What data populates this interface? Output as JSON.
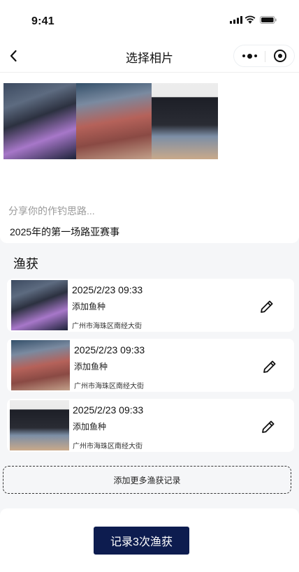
{
  "status": {
    "time": "9:41"
  },
  "nav": {
    "title": "选择相片"
  },
  "share": {
    "placeholder": "分享你的作钓思路...",
    "text": "2025年的第一场路亚赛事"
  },
  "catch_section": {
    "title": "渔获"
  },
  "catches": [
    {
      "datetime": "2025/2/23 09:33",
      "species": "添加鱼种",
      "location": "广州市海珠区南经大街"
    },
    {
      "datetime": "2025/2/23 09:33",
      "species": "添加鱼种",
      "location": "广州市海珠区南经大街"
    },
    {
      "datetime": "2025/2/23 09:33",
      "species": "添加鱼种",
      "location": "广州市海珠区南经大街"
    }
  ],
  "add_more_label": "添加更多渔获记录",
  "submit_label": "记录3次渔获",
  "icons": [
    "signal-icon",
    "wifi-icon",
    "battery-icon",
    "back-arrow-icon",
    "more-dots-icon",
    "close-target-icon",
    "edit-pencil-icon"
  ],
  "colors": {
    "primary": "#0d1c4f",
    "background": "#f5f6f8",
    "card": "#ffffff"
  }
}
